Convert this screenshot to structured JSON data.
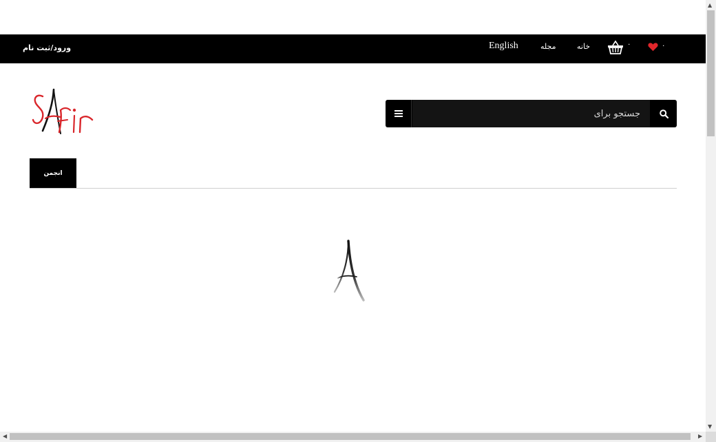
{
  "topbar": {
    "login_label": "ورود/ثبت نام",
    "nav": {
      "english": "English",
      "magazine": "مجله",
      "home": "خانه"
    },
    "cart_count": "۰",
    "wishlist_count": "۰",
    "icons": {
      "cart": "basket-icon",
      "wishlist": "heart-icon"
    },
    "colors": {
      "bar": "#000000",
      "heart": "#e0262b"
    }
  },
  "header": {
    "logo_text": "SAFir",
    "logo_colors": {
      "primary": "#d9262b",
      "accent": "#111111"
    }
  },
  "search": {
    "placeholder": "جستجو برای",
    "value": "",
    "menu_icon": "menu-icon",
    "search_icon": "search-icon"
  },
  "tabs": [
    {
      "label": "انجمن",
      "active": true
    }
  ],
  "loader": {
    "icon": "eiffel-loader-icon"
  }
}
